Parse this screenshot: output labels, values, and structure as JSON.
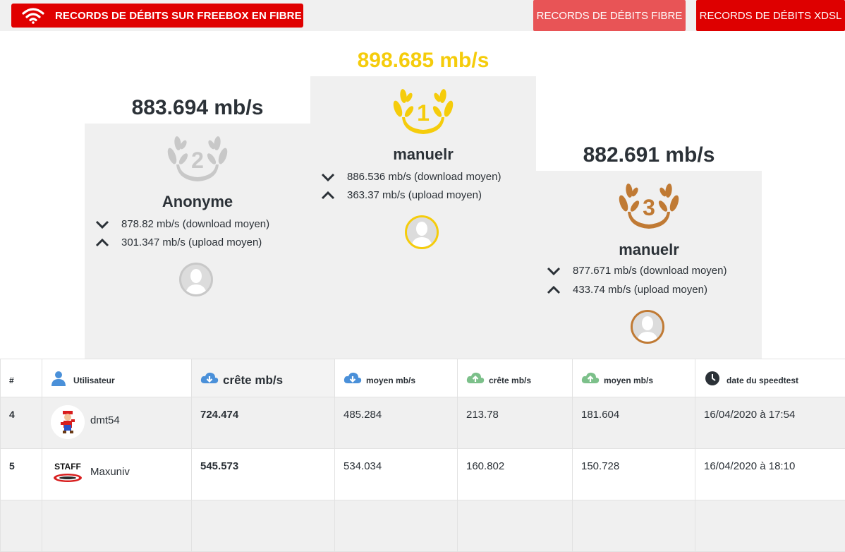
{
  "header": {
    "brand_title": "RECORDS DE DÉBITS SUR FREEBOX EN FIBRE",
    "nav": [
      {
        "label": "RECORDS DE DÉBITS FIBRE"
      },
      {
        "label": "RECORDS DE DÉBITS XDSL"
      }
    ]
  },
  "podium": {
    "first": {
      "rank": "1",
      "speed": "898.685 mb/s",
      "user": "manuelr",
      "download": "886.536 mb/s (download moyen)",
      "upload": "363.37 mb/s (upload moyen)",
      "color": "#f5cc0b"
    },
    "second": {
      "rank": "2",
      "speed": "883.694 mb/s",
      "user": "Anonyme",
      "download": "878.82 mb/s (download moyen)",
      "upload": "301.347 mb/s (upload moyen)",
      "color": "#c8c8c8"
    },
    "third": {
      "rank": "3",
      "speed": "882.691 mb/s",
      "user": "manuelr",
      "download": "877.671 mb/s (download moyen)",
      "upload": "433.74 mb/s (upload moyen)",
      "color": "#c07a34"
    }
  },
  "table": {
    "headers": {
      "rank": "#",
      "user": "Utilisateur",
      "dl_peak": "crête mb/s",
      "dl_avg": "moyen mb/s",
      "ul_peak": "crête mb/s",
      "ul_avg": "moyen mb/s",
      "date": "date du speedtest"
    },
    "rows": [
      {
        "rank": "4",
        "user": "dmt54",
        "dl_peak": "724.474",
        "dl_avg": "485.284",
        "ul_peak": "213.78",
        "ul_avg": "181.604",
        "date": "16/04/2020 à 17:54"
      },
      {
        "rank": "5",
        "user": "Maxuniv",
        "dl_peak": "545.573",
        "dl_avg": "534.034",
        "ul_peak": "160.802",
        "ul_avg": "150.728",
        "date": "16/04/2020 à 18:10"
      }
    ]
  },
  "colors": {
    "brand_red": "#e00000",
    "download_blue": "#4a90d9",
    "upload_green": "#7cc08a",
    "gold": "#f5cc0b",
    "silver": "#c8c8c8",
    "bronze": "#c07a34"
  }
}
